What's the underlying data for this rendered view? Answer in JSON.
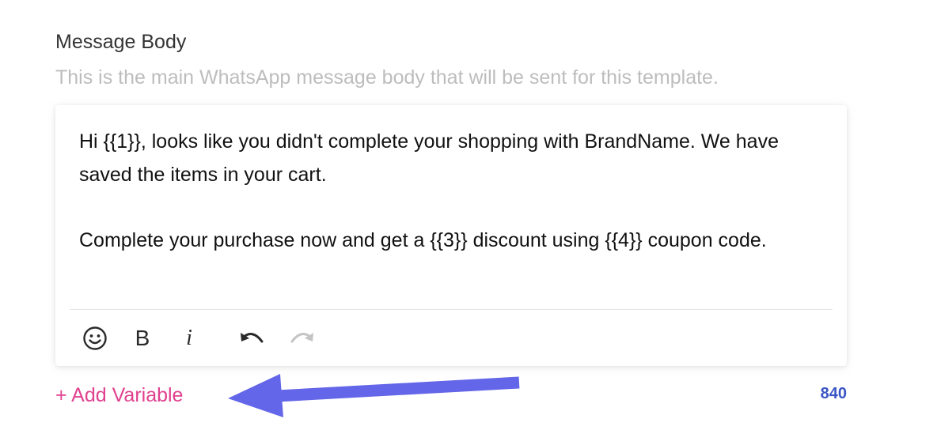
{
  "section": {
    "title": "Message Body",
    "description": "This is the main WhatsApp message body that will be sent for this template."
  },
  "editor": {
    "paragraphs": [
      "Hi {{1}}, looks like you didn't complete your shopping with BrandName. We have saved the items in your cart.",
      "Complete your purchase now and get a {{3}} discount using {{4}} coupon code."
    ],
    "toolbar": {
      "emoji_icon": "smiley-face-icon",
      "bold_label": "B",
      "italic_label": "i",
      "undo_icon": "undo-icon",
      "redo_icon": "redo-icon"
    }
  },
  "footer": {
    "add_variable_label": "+ Add Variable",
    "char_count": "840"
  },
  "colors": {
    "accent_pink": "#e0418f",
    "count_blue": "#3b55c5",
    "annotation_arrow": "#6366e8"
  }
}
